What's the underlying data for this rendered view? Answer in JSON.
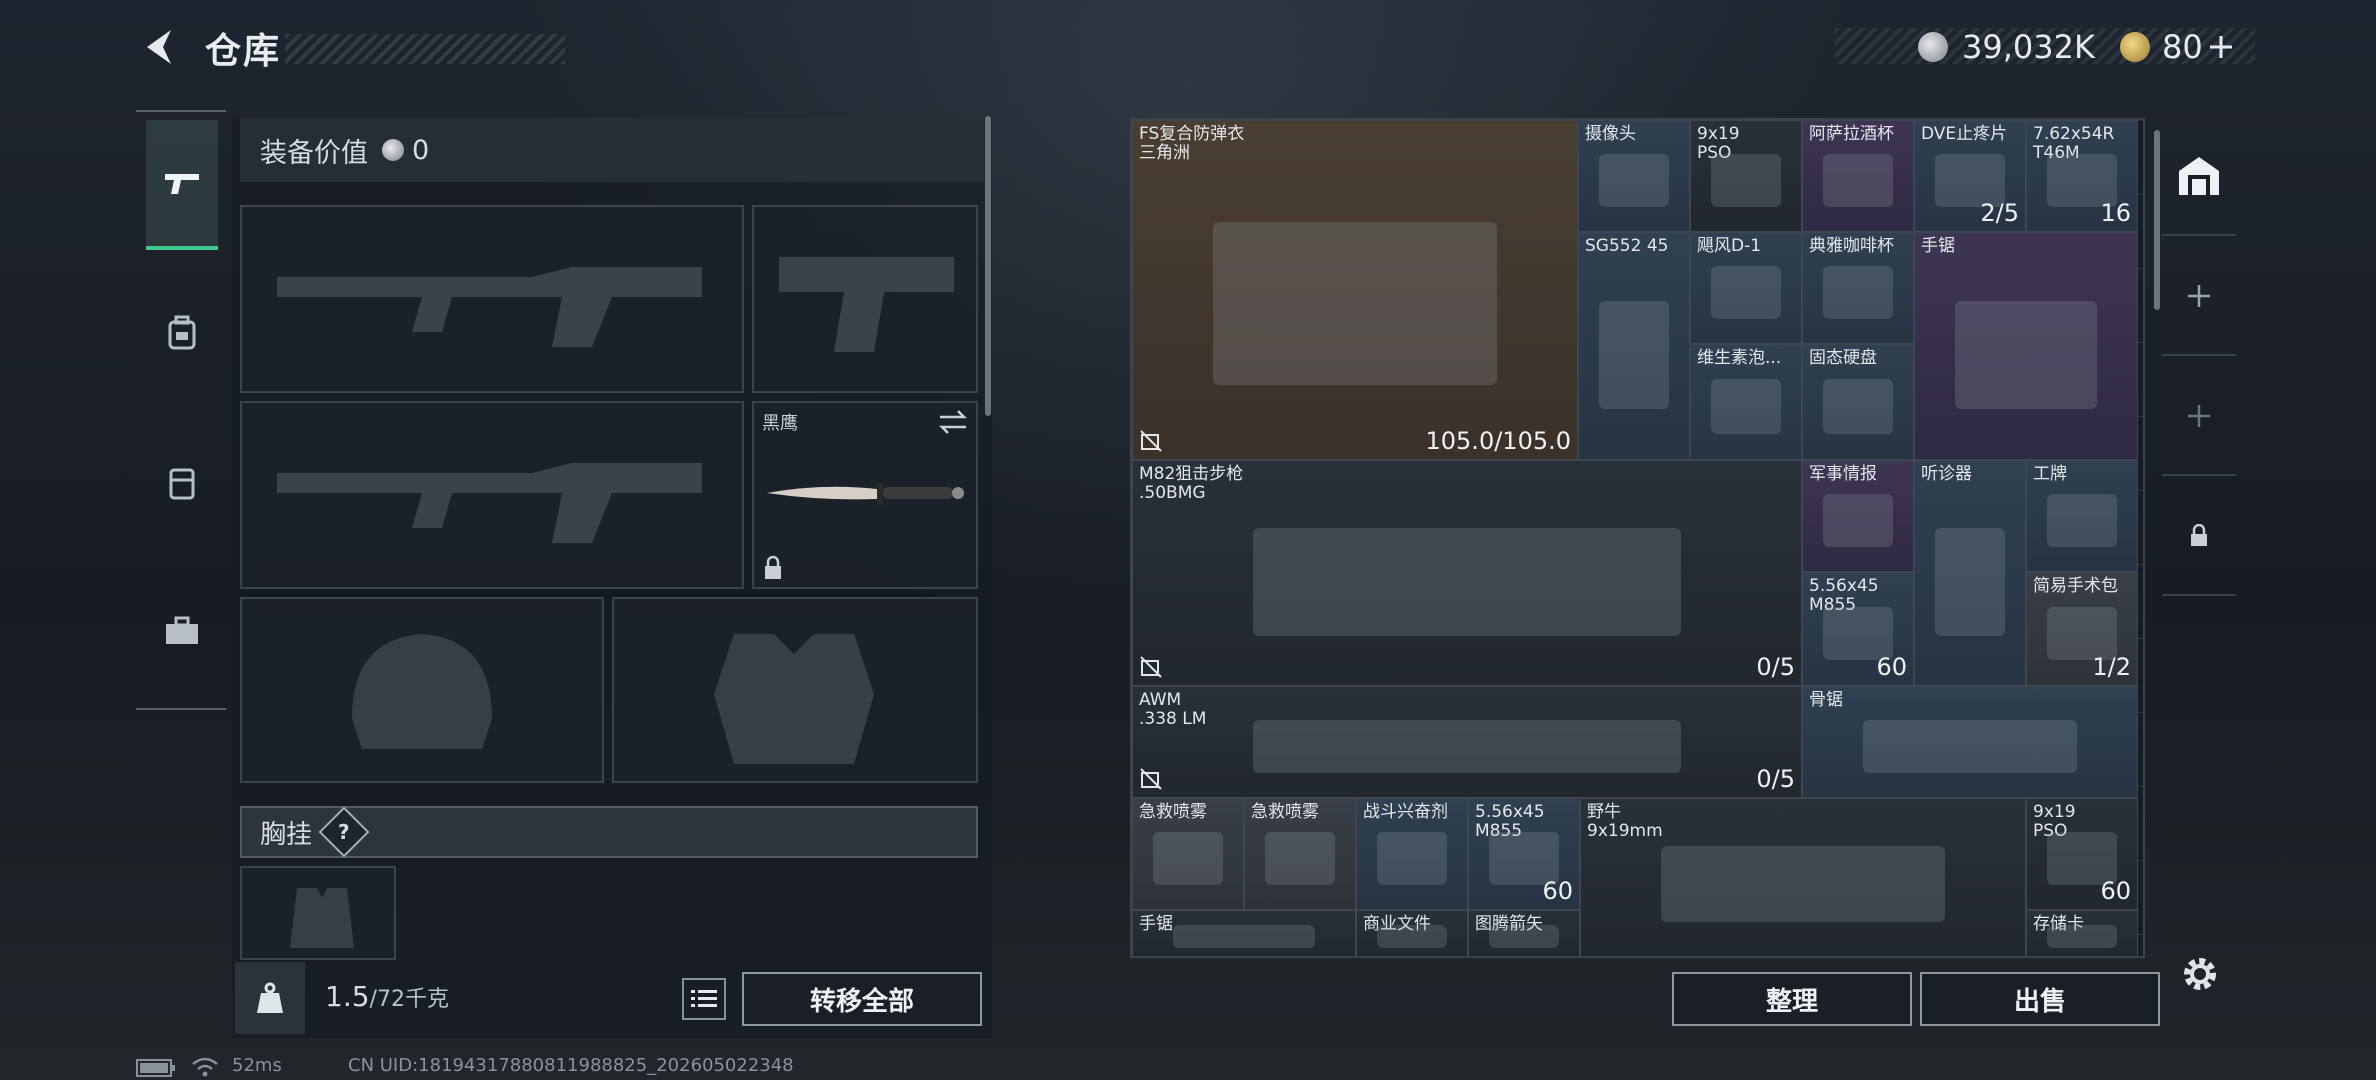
{
  "header": {
    "title": "仓库"
  },
  "currency": {
    "silver": "39,032K",
    "gold": "80"
  },
  "left": {
    "equip_value_label": "装备价值",
    "equip_value": "0",
    "knife_label": "黑鹰",
    "chest_label": "胸挂",
    "help": "?",
    "weight_value": "1.5",
    "weight_max": "/72千克",
    "transfer_all": "转移全部"
  },
  "stash": {
    "items": [
      {
        "name": "FS复合防弹衣\n三角洲",
        "count": "105.0/105.0",
        "color": "brown"
      },
      {
        "name": "摄像头",
        "count": "",
        "color": "blue"
      },
      {
        "name": "9x19\nPSO",
        "count": "",
        "color": "dark"
      },
      {
        "name": "阿萨拉酒杯",
        "count": "",
        "color": "purple"
      },
      {
        "name": "DVE止疼片",
        "count": "2/5",
        "color": "blue"
      },
      {
        "name": "7.62x54R\nT46M",
        "count": "16",
        "color": "blue"
      },
      {
        "name": "SG552 45",
        "count": "",
        "color": "blue"
      },
      {
        "name": "飓风D-1",
        "count": "",
        "color": "blue"
      },
      {
        "name": "典雅咖啡杯",
        "count": "",
        "color": "blue"
      },
      {
        "name": "手锯",
        "count": "",
        "color": "purple"
      },
      {
        "name": "维生素泡...",
        "count": "",
        "color": "blue"
      },
      {
        "name": "固态硬盘",
        "count": "",
        "color": "blue"
      },
      {
        "name": "M82狙击步枪\n.50BMG",
        "count": "0/5",
        "color": "dark"
      },
      {
        "name": "军事情报",
        "count": "",
        "color": "purple"
      },
      {
        "name": "听诊器",
        "count": "",
        "color": "blue"
      },
      {
        "name": "工牌",
        "count": "",
        "color": "blue"
      },
      {
        "name": "5.56x45\nM855",
        "count": "60",
        "color": "blue"
      },
      {
        "name": "简易手术包",
        "count": "1/2",
        "color": "gray"
      },
      {
        "name": "AWM\n.338 LM",
        "count": "0/5",
        "color": "dark"
      },
      {
        "name": "骨锯",
        "count": "",
        "color": "blue"
      },
      {
        "name": "急救喷雾",
        "count": "",
        "color": "gray"
      },
      {
        "name": "急救喷雾",
        "count": "",
        "color": "gray"
      },
      {
        "name": "战斗兴奋剂",
        "count": "",
        "color": "blue"
      },
      {
        "name": "5.56x45\nM855",
        "count": "60",
        "color": "blue"
      },
      {
        "name": "野牛\n9x19mm",
        "count": "",
        "color": "dark"
      },
      {
        "name": "9x19\nPSO",
        "count": "60",
        "color": "dark"
      },
      {
        "name": "手锯",
        "count": "",
        "color": "dark"
      },
      {
        "name": "商业文件",
        "count": "",
        "color": "dark"
      },
      {
        "name": "图腾箭矢",
        "count": "",
        "color": "dark"
      },
      {
        "name": "存储卡",
        "count": "",
        "color": "dark"
      }
    ],
    "organize": "整理",
    "sell": "出售"
  },
  "status": {
    "ping": "52ms",
    "uid": "CN UID:18194317880811988825_202605022348"
  }
}
